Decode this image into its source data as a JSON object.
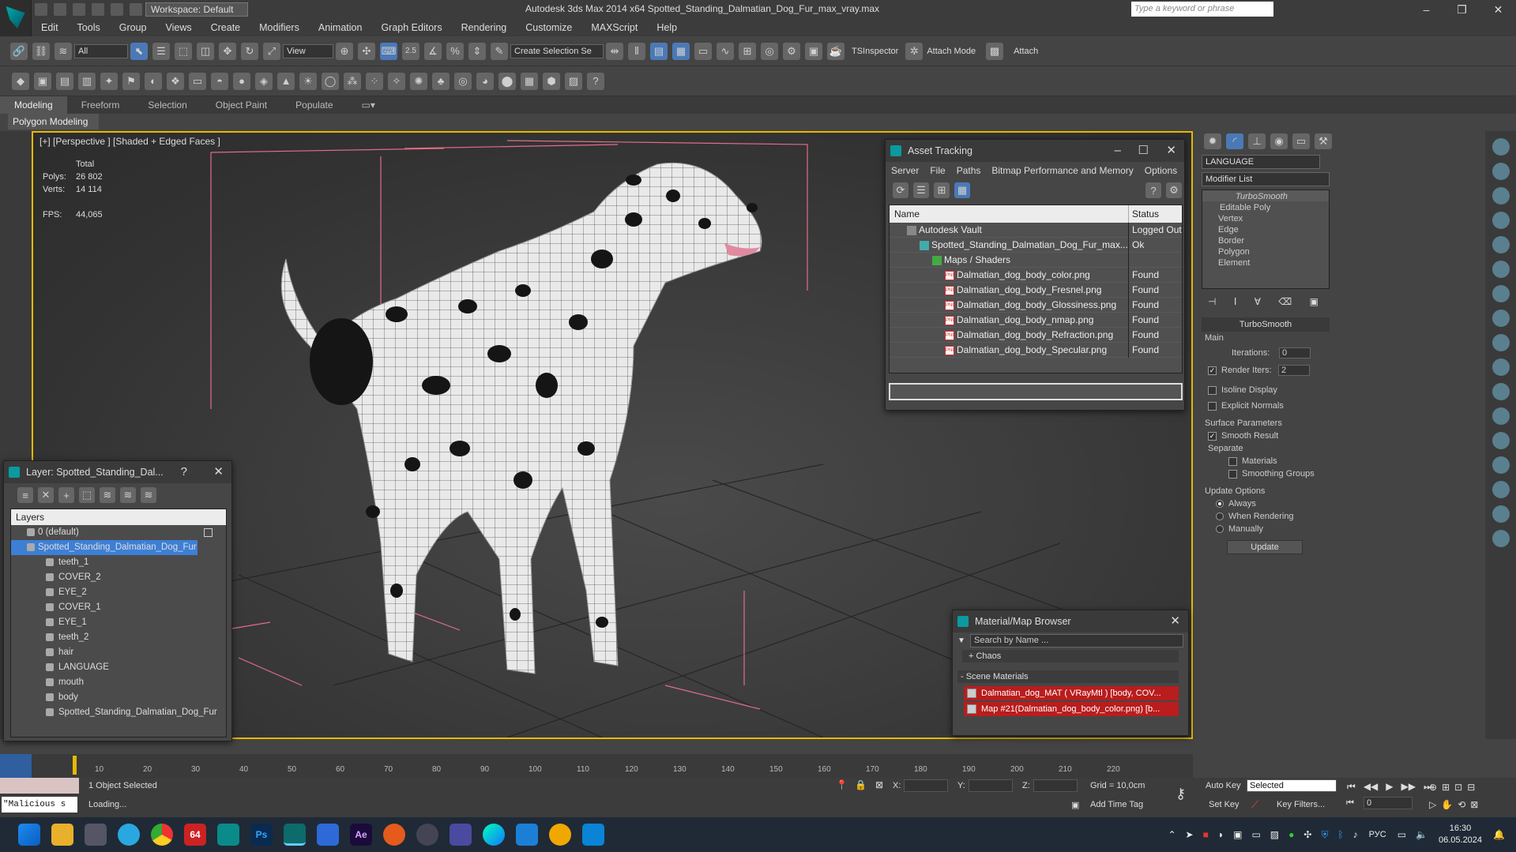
{
  "titlebar": {
    "workspace": "Workspace: Default",
    "app_title": "Autodesk 3ds Max  2014 x64    Spotted_Standing_Dalmatian_Dog_Fur_max_vray.max",
    "search_placeholder": "Type a keyword or phrase"
  },
  "menu": [
    "Edit",
    "Tools",
    "Group",
    "Views",
    "Create",
    "Modifiers",
    "Animation",
    "Graph Editors",
    "Rendering",
    "Customize",
    "MAXScript",
    "Help"
  ],
  "toolbar": {
    "filter": "All",
    "refcoord": "View",
    "selset": "Create Selection Se",
    "spinner_snap": "2.5",
    "tsinspector": "TSInspector",
    "attach_mode": "Attach Mode",
    "attach": "Attach"
  },
  "ribbon": {
    "tabs": [
      "Modeling",
      "Freeform",
      "Selection",
      "Object Paint",
      "Populate"
    ],
    "active": "Modeling",
    "panel": "Polygon Modeling"
  },
  "viewport": {
    "label": "[+] [Perspective ] [Shaded + Edged Faces ]",
    "total": "Total",
    "polys_label": "Polys:",
    "polys": "26 802",
    "verts_label": "Verts:",
    "verts": "14 114",
    "fps_label": "FPS:",
    "fps": "44,065"
  },
  "asset_tracking": {
    "title": "Asset Tracking",
    "menu": [
      "Server",
      "File",
      "Paths",
      "Bitmap Performance and Memory",
      "Options"
    ],
    "col_name": "Name",
    "col_status": "Status",
    "rows": [
      {
        "name": "Autodesk Vault",
        "status": "Logged Out"
      },
      {
        "name": "Spotted_Standing_Dalmatian_Dog_Fur_max...",
        "status": "Ok"
      },
      {
        "name": "Maps / Shaders",
        "status": ""
      },
      {
        "name": "Dalmatian_dog_body_color.png",
        "status": "Found"
      },
      {
        "name": "Dalmatian_dog_body_Fresnel.png",
        "status": "Found"
      },
      {
        "name": "Dalmatian_dog_body_Glossiness.png",
        "status": "Found"
      },
      {
        "name": "Dalmatian_dog_body_nmap.png",
        "status": "Found"
      },
      {
        "name": "Dalmatian_dog_body_Refraction.png",
        "status": "Found"
      },
      {
        "name": "Dalmatian_dog_body_Specular.png",
        "status": "Found"
      }
    ]
  },
  "layer_explorer": {
    "title": "Layer: Spotted_Standing_Dal...",
    "help": "?",
    "header": "Layers",
    "default_layer": "0 (default)",
    "active_layer": "Spotted_Standing_Dalmatian_Dog_Fur",
    "children": [
      "teeth_1",
      "COVER_2",
      "EYE_2",
      "COVER_1",
      "EYE_1",
      "teeth_2",
      "hair",
      "LANGUAGE",
      "mouth",
      "body",
      "Spotted_Standing_Dalmatian_Dog_Fur"
    ]
  },
  "material_browser": {
    "title": "Material/Map Browser",
    "search_placeholder": "Search by Name ...",
    "chaos": "+ Chaos",
    "scene_materials": "- Scene Materials",
    "items": [
      "Dalmatian_dog_MAT ( VRayMtl ) [body, COV...",
      "Map #21(Dalmatian_dog_body_color.png) [b..."
    ]
  },
  "command_panel": {
    "object_name": "LANGUAGE",
    "modifier_list": "Modifier List",
    "stack": [
      "TurboSmooth",
      "Editable Poly",
      "Vertex",
      "Edge",
      "Border",
      "Polygon",
      "Element"
    ],
    "rollout": "TurboSmooth",
    "main": "Main",
    "iterations_label": "Iterations:",
    "iterations": "0",
    "render_iters_label": "Render Iters:",
    "render_iters": "2",
    "isoline": "Isoline Display",
    "explicit_normals": "Explicit Normals",
    "surface_params": "Surface Parameters",
    "smooth_result": "Smooth Result",
    "separate": "Separate",
    "materials": "Materials",
    "smoothing_groups": "Smoothing Groups",
    "update_options": "Update Options",
    "always": "Always",
    "when_rendering": "When Rendering",
    "manually": "Manually",
    "update": "Update"
  },
  "timeline": {
    "ticks": [
      "10",
      "20",
      "30",
      "40",
      "50",
      "60",
      "70",
      "80",
      "90",
      "100",
      "110",
      "120",
      "130",
      "140",
      "150",
      "160",
      "170",
      "180",
      "190",
      "200",
      "210",
      "220"
    ]
  },
  "status": {
    "selected": "1 Object Selected",
    "loading": "Loading...",
    "x_label": "X:",
    "y_label": "Y:",
    "z_label": "Z:",
    "grid": "Grid = 10,0cm",
    "add_time_tag": "Add Time Tag",
    "auto_key": "Auto Key",
    "set_key": "Set Key",
    "key_mode": "Selected",
    "key_filters": "Key Filters...",
    "frame": "0",
    "script": "\"Malicious s"
  },
  "taskbar": {
    "badge": "64",
    "lang": "РУС",
    "time": "16:30",
    "date": "06.05.2024"
  }
}
